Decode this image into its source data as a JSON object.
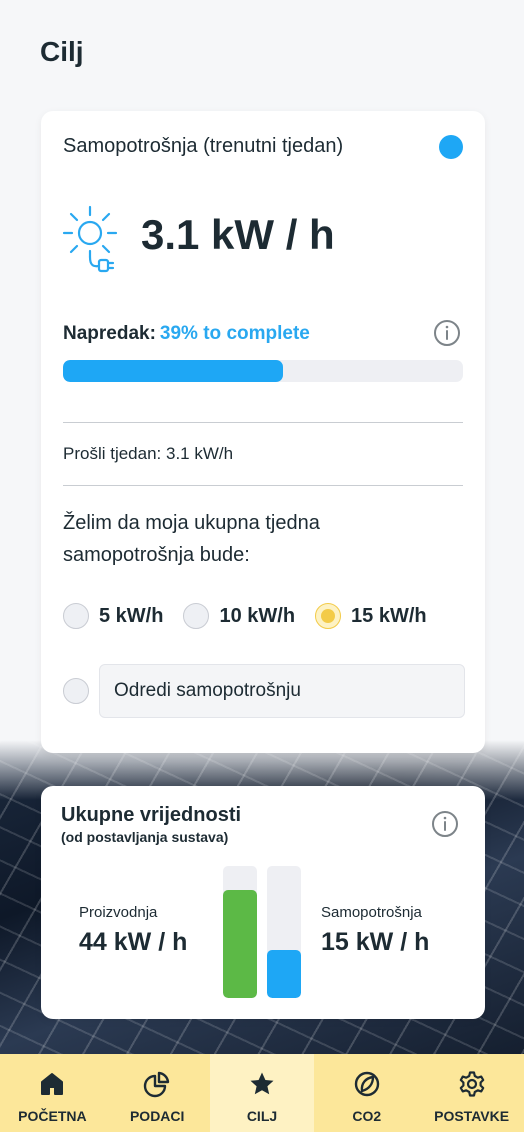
{
  "page": {
    "title": "Cilj"
  },
  "goal_card": {
    "title": "Samopotrošnja (trenutni tjedan)",
    "status_color": "#1ea7f5",
    "current_value": "3.1 kW / h",
    "progress_label": "Napredak:",
    "progress_text": "39% to complete",
    "progress_fraction": 0.55,
    "last_week": "Prošli tjedan: 3.1 kW/h",
    "question": "Želim da moja ukupna tjedna samopotrošnja bude:",
    "options": [
      {
        "label": "5 kW/h",
        "selected": false
      },
      {
        "label": "10 kW/h",
        "selected": false
      },
      {
        "label": "15 kW/h",
        "selected": true
      }
    ],
    "custom_placeholder": "Odredi samopotrošnju"
  },
  "totals_card": {
    "title": "Ukupne vrijednosti",
    "subtitle": "(od postavljanja sustava)",
    "production_label": "Proizvodnja",
    "production_value": "44 kW / h",
    "production_fraction": 0.82,
    "production_color": "#5cb946",
    "consumption_label": "Samopotrošnja",
    "consumption_value": "15 kW / h",
    "consumption_fraction": 0.36,
    "consumption_color": "#1ea7f5"
  },
  "nav": {
    "items": [
      {
        "label": "POČETNA",
        "icon": "home-icon",
        "active": false
      },
      {
        "label": "PODACI",
        "icon": "pie-chart-icon",
        "active": false
      },
      {
        "label": "CILJ",
        "icon": "star-icon",
        "active": true
      },
      {
        "label": "CO2",
        "icon": "leaf-globe-icon",
        "active": false
      },
      {
        "label": "POSTAVKE",
        "icon": "gear-icon",
        "active": false
      }
    ]
  },
  "colors": {
    "accent_blue": "#1ea7f5",
    "accent_yellow": "#f3cb48",
    "nav_background": "#fce79a",
    "nav_active": "#fef2c3",
    "text_dark": "#1d2b33"
  }
}
